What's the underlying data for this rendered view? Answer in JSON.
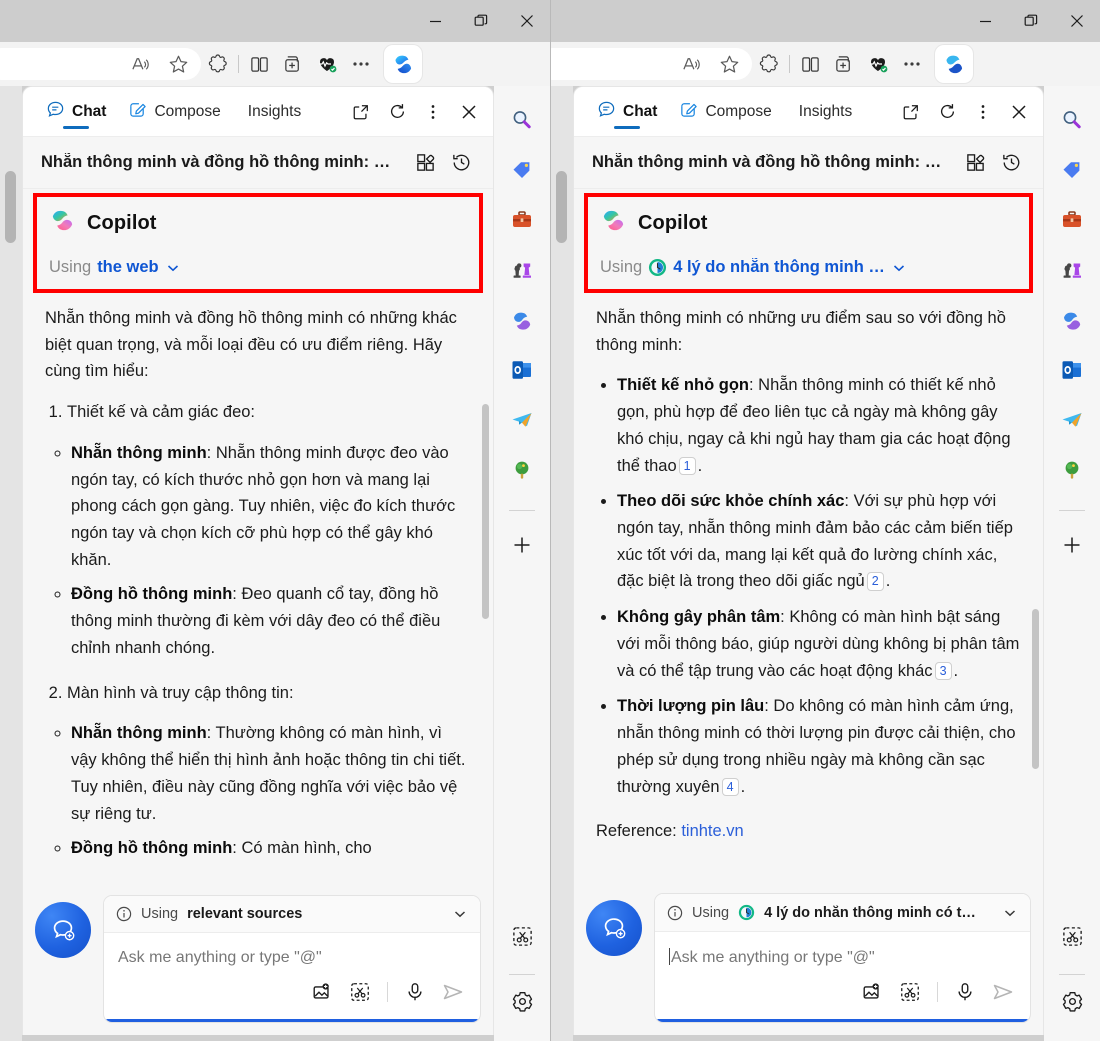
{
  "window_controls": {
    "minimize": "minimize-icon",
    "restore": "restore-icon",
    "close": "close-icon"
  },
  "browser_toolbar": {
    "read_aloud": "read-aloud-icon",
    "favorite": "star-icon",
    "extensions": "extensions-icon",
    "split_screen": "split-screen-icon",
    "collections": "collections-icon",
    "browser_essentials": "browser-essentials-icon",
    "settings_more": "more-options-icon",
    "copilot": "copilot-icon"
  },
  "panel_tabs": [
    {
      "label": "Chat",
      "icon": "chat-icon",
      "active": true
    },
    {
      "label": "Compose",
      "icon": "compose-icon",
      "active": false
    },
    {
      "label": "Insights",
      "icon": "",
      "active": false
    }
  ],
  "panel_header_actions": {
    "open_in_new": "open-in-new-icon",
    "refresh": "refresh-icon",
    "more": "more-vertical-icon",
    "close": "close-icon"
  },
  "conversation": {
    "title": "Nhẵn thông minh và đồng hồ thông minh: …",
    "apps_icon": "apps-plugin-icon",
    "history_icon": "history-icon"
  },
  "left": {
    "assistant_name": "Copilot",
    "using_label": "Using",
    "using_value": "the web",
    "using_has_source_icon": false,
    "intro": "Nhẵn thông minh và đồng hồ thông minh có những khác biệt quan trọng, và mỗi loại đều có ưu điểm riêng. Hãy cùng tìm hiểu:",
    "sections": [
      {
        "number": "1.",
        "heading": "Thiết kế và cảm giác đeo:",
        "items": [
          {
            "term": "Nhẵn thông minh",
            "text": ": Nhẵn thông minh được đeo vào ngón tay, có kích thước nhỏ gọn hơn và mang lại phong cách gọn gàng. Tuy nhiên, việc đo kích thước ngón tay và chọn kích cỡ phù hợp có thể gây khó khăn."
          },
          {
            "term": "Đồng hồ thông minh",
            "text": ": Đeo quanh cổ tay, đồng hồ thông minh thường đi kèm với dây đeo có thể điều chỉnh nhanh chóng."
          }
        ]
      },
      {
        "number": "2.",
        "heading": "Màn hình và truy cập thông tin:",
        "items": [
          {
            "term": "Nhẵn thông minh",
            "text": ": Thường không có màn hình, vì vậy không thể hiển thị hình ảnh hoặc thông tin chi tiết. Tuy nhiên, điều này cũng đồng nghĩa với việc bảo vệ sự riêng tư."
          },
          {
            "term": "Đồng hồ thông minh",
            "text": ": Có màn hình, cho"
          }
        ]
      }
    ],
    "composer": {
      "source_label": "Using",
      "source_value": "relevant sources",
      "source_has_icon": false,
      "placeholder": "Ask me anything or type \"@\"",
      "caret_visible": false,
      "actions": [
        "add-image-icon",
        "snip-icon",
        "microphone-icon",
        "send-icon"
      ]
    }
  },
  "right": {
    "assistant_name": "Copilot",
    "using_label": "Using",
    "using_value": "4 lý do nhẵn thông minh …",
    "using_has_source_icon": true,
    "intro": "Nhẵn thông minh có những ưu điểm sau so với đồng hồ thông minh:",
    "bullets": [
      {
        "term": "Thiết kế nhỏ gọn",
        "text": ": Nhẵn thông minh có thiết kế nhỏ gọn, phù hợp để đeo liên tục cả ngày mà không gây khó chịu, ngay cả khi ngủ hay tham gia các hoạt động thể thao",
        "cite": "1"
      },
      {
        "term": "Theo dõi sức khỏe chính xác",
        "text": ": Với sự phù hợp với ngón tay, nhẵn thông minh đảm bảo các cảm biến tiếp xúc tốt với da, mang lại kết quả đo lường chính xác, đặc biệt là trong theo dõi giấc ngủ",
        "cite": "2"
      },
      {
        "term": "Không gây phân tâm",
        "text": ": Không có màn hình bật sáng với mỗi thông báo, giúp người dùng không bị phân tâm và có thể tập trung vào các hoạt động khác",
        "cite": "3"
      },
      {
        "term": "Thời lượng pin lâu",
        "text": ": Do không có màn hình cảm ứng, nhẵn thông minh có thời lượng pin được cải thiện, cho phép sử dụng trong nhiều ngày mà không cần sạc thường xuyên",
        "cite": "4"
      }
    ],
    "reference_label": "Reference:",
    "reference_link": "tinhte.vn",
    "composer": {
      "source_label": "Using",
      "source_value": "4 lý do nhẵn thông minh có t…",
      "source_has_icon": true,
      "placeholder": "Ask me anything or type \"@\"",
      "caret_visible": true,
      "actions": [
        "add-image-icon",
        "snip-icon",
        "microphone-icon",
        "send-icon"
      ]
    }
  },
  "rail": {
    "items": [
      {
        "name": "search-icon"
      },
      {
        "name": "tag-icon"
      },
      {
        "name": "briefcase-icon"
      },
      {
        "name": "chess-icon"
      },
      {
        "name": "microsoft365-icon"
      },
      {
        "name": "outlook-icon"
      },
      {
        "name": "telegram-icon"
      },
      {
        "name": "tree-icon"
      }
    ],
    "add_label": "+",
    "bottom_items": [
      {
        "name": "snip-icon"
      },
      {
        "name": "settings-gear-icon"
      }
    ]
  },
  "colors": {
    "highlight_border": "#ff0000",
    "accent_blue": "#0f56d3",
    "tab_underline": "#0f6cbd",
    "link": "#2b5fd9",
    "composer_underline": "#1f5fe0"
  }
}
